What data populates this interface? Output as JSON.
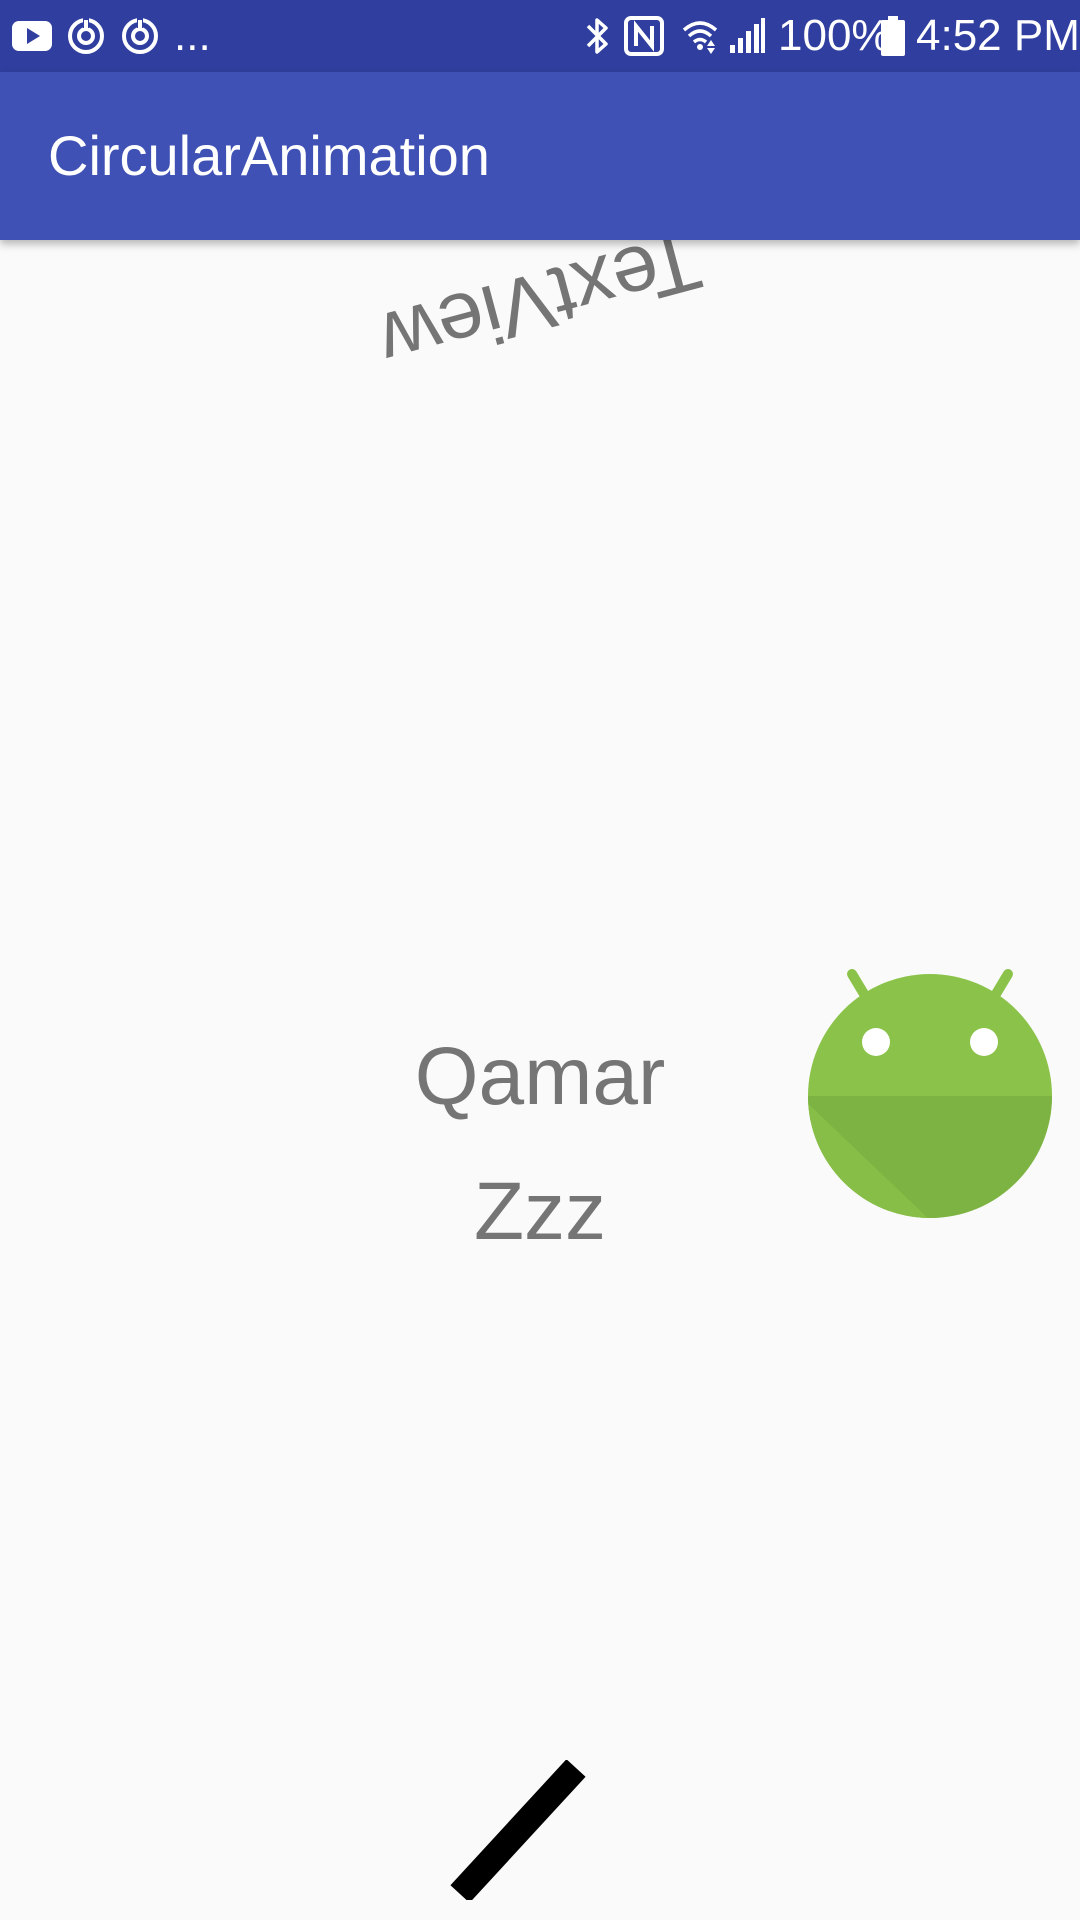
{
  "status_bar": {
    "left_icons": [
      "youtube-icon",
      "sync-icon",
      "sync-icon"
    ],
    "overflow": "...",
    "right_icons": [
      "bluetooth-icon",
      "nfc-icon",
      "wifi-icon",
      "cell-signal-icon"
    ],
    "battery": "100%",
    "time": "4:52 PM"
  },
  "app_bar": {
    "title": "CircularAnimation"
  },
  "content": {
    "rotated_text": "TextView",
    "name_text": "Qamar",
    "sleep_text": "Zzz"
  },
  "colors": {
    "status_bar": "#303f9f",
    "app_bar": "#3f51b5",
    "background": "#fafafa",
    "text": "#757575",
    "android_green": "#8bc34a"
  }
}
